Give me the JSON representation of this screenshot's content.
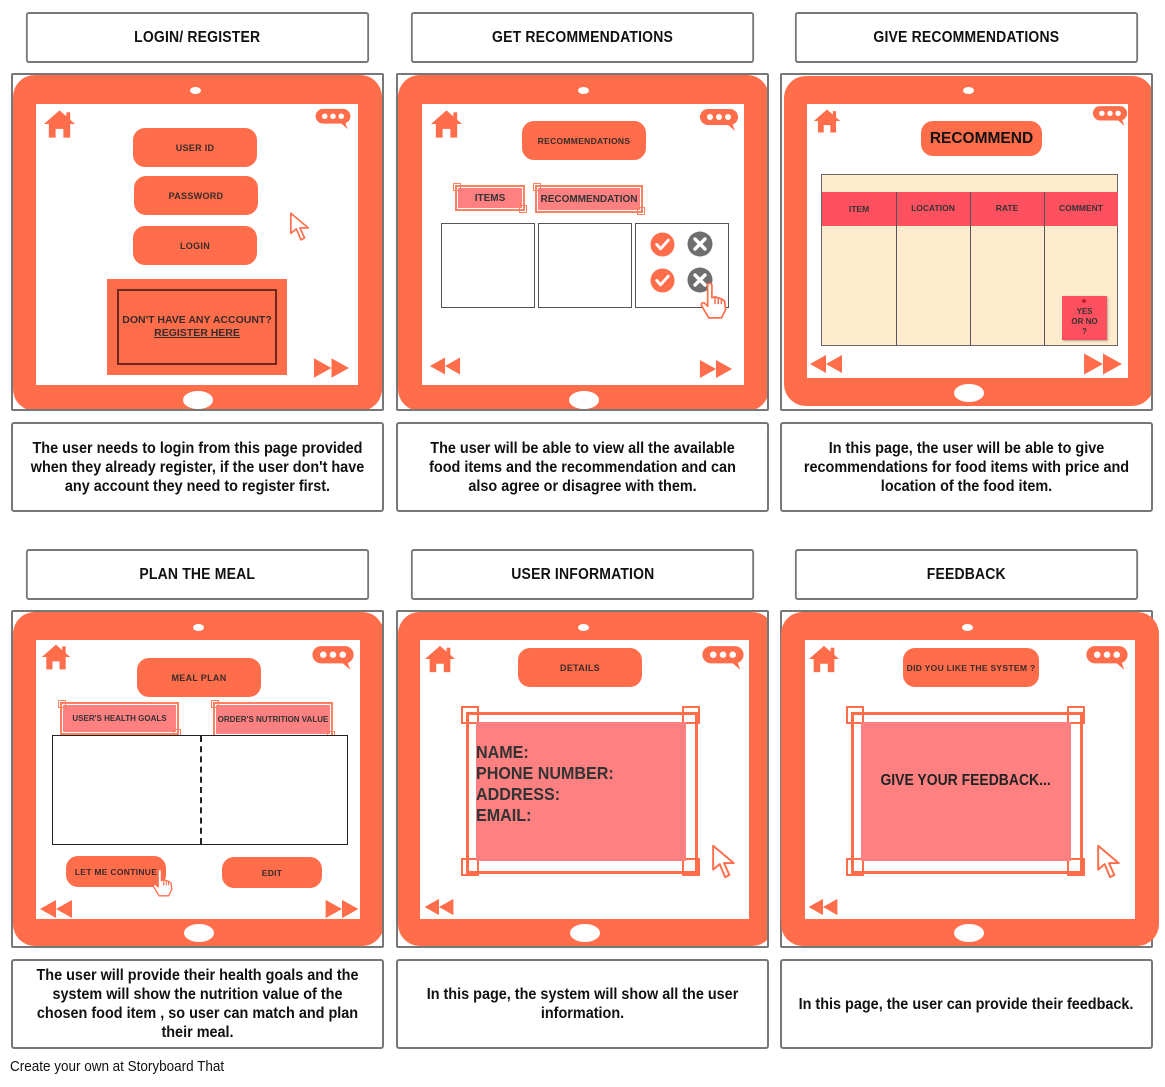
{
  "footer": "Create your own at Storyboard That",
  "colors": {
    "accent": "#ff6d4a",
    "tag_pink": "#ff8080",
    "table_header": "#ff5060",
    "table_body": "#ffebcd"
  },
  "panels": [
    {
      "title": "LOGIN/ REGISTER",
      "caption": "The user needs to login from this page provided when they already register, if the user don't have any account they need to register first.",
      "screen": {
        "buttons": [
          "USER ID",
          "PASSWORD",
          "LOGIN"
        ],
        "register_prompt": "DON'T HAVE ANY ACCOUNT?",
        "register_link": "REGISTER HERE",
        "icons": [
          "home-icon",
          "chat-bubble-icon",
          "cursor-arrow-icon",
          "fast-forward-icon"
        ]
      }
    },
    {
      "title": "GET RECOMMENDATIONS",
      "caption": "The user will be able to view all the available food items and the recommendation and can also agree or disagree with them.",
      "screen": {
        "header": "RECOMMENDATIONS",
        "tags": [
          "ITEMS",
          "RECOMMENDATION"
        ],
        "icons": [
          "home-icon",
          "chat-bubble-icon",
          "check-circle-icon",
          "x-circle-icon",
          "hand-pointer-icon",
          "rewind-icon",
          "fast-forward-icon"
        ]
      }
    },
    {
      "title": "GIVE RECOMMENDATIONS",
      "caption": "In this page, the user will be able to give recommendations for food items with price and location of the food item.",
      "screen": {
        "header": "RECOMMEND",
        "columns": [
          "ITEM",
          "LOCATION",
          "RATE",
          "COMMENT"
        ],
        "sticky_note": "YES OR NO ?",
        "icons": [
          "home-icon",
          "chat-bubble-icon",
          "rewind-icon",
          "fast-forward-icon"
        ]
      }
    },
    {
      "title": "PLAN THE MEAL",
      "caption": "The user will provide their health goals and the system will show the nutrition value of the chosen food item , so user can match and plan their meal.",
      "screen": {
        "header": "MEAL PLAN",
        "tags": [
          "USER'S HEALTH GOALS",
          "ORDER'S NUTRITION VALUE"
        ],
        "buttons": [
          "LET ME CONTINUE",
          "EDIT"
        ],
        "icons": [
          "home-icon",
          "chat-bubble-icon",
          "hand-pointer-icon",
          "rewind-icon",
          "fast-forward-icon"
        ]
      }
    },
    {
      "title": "USER INFORMATION",
      "caption": "In this page, the system will show all the user information.",
      "screen": {
        "header": "DETAILS",
        "fields": [
          "NAME:",
          "PHONE NUMBER:",
          "ADDRESS:",
          "EMAIL:"
        ],
        "icons": [
          "home-icon",
          "chat-bubble-icon",
          "cursor-arrow-icon",
          "rewind-icon"
        ]
      }
    },
    {
      "title": "FEEDBACK",
      "caption": "In this page, the user can provide their feedback.",
      "screen": {
        "header": "DID YOU LIKE THE SYSTEM ?",
        "placeholder": "GIVE YOUR FEEDBACK...",
        "icons": [
          "home-icon",
          "chat-bubble-icon",
          "cursor-arrow-icon",
          "rewind-icon"
        ]
      }
    }
  ]
}
